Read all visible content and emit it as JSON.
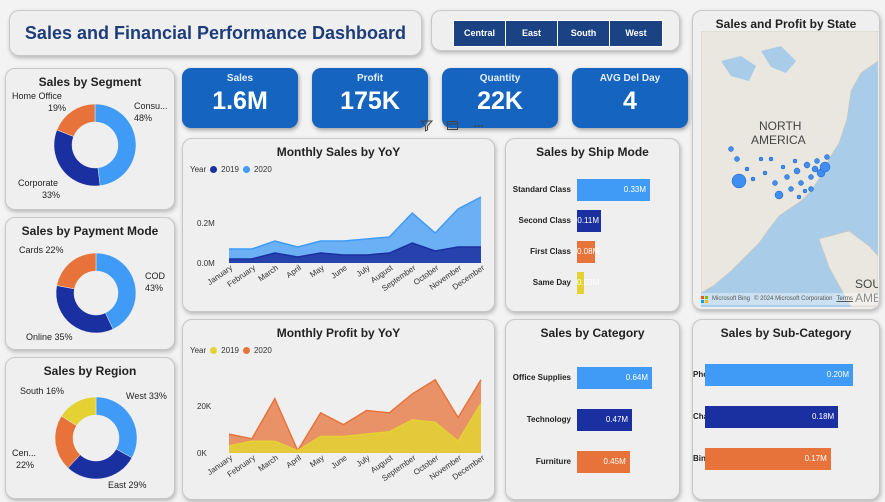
{
  "title": "Sales and Financial Performance Dashboard",
  "region_slicer": [
    "Central",
    "East",
    "South",
    "West"
  ],
  "kpis": [
    {
      "label": "Sales",
      "value": "1.6M"
    },
    {
      "label": "Profit",
      "value": "175K"
    },
    {
      "label": "Quantity",
      "value": "22K"
    },
    {
      "label": "AVG Del Day",
      "value": "4"
    }
  ],
  "colors": {
    "dark_blue": "#1a2fa0",
    "light_blue": "#3f9bf5",
    "orange": "#e8733a",
    "yellow": "#e3d232",
    "kpi_blue": "#1565c0",
    "title_blue": "#1c3d7a"
  },
  "map": {
    "title": "Sales and Profit by State",
    "labels": [
      "NORTH",
      "AMERICA",
      "SOU",
      "AME"
    ],
    "attribution": "© 2024 Microsoft Corporation",
    "logo": "Microsoft Bing",
    "terms": "Terms"
  },
  "visual_icons": [
    "filter-icon",
    "focus-mode-icon",
    "more-options-icon"
  ],
  "chart_data": [
    {
      "type": "pie",
      "title": "Sales by Segment",
      "labels": [
        "Consu...",
        "Corporate",
        "Home Office"
      ],
      "label_display": [
        "Consu...",
        "Corporate",
        "Home Office"
      ],
      "pct_display": [
        "48%",
        "33%",
        "19%"
      ],
      "values": [
        48,
        33,
        19
      ],
      "colors": [
        "#3f9bf5",
        "#1a2fa0",
        "#e8733a"
      ]
    },
    {
      "type": "pie",
      "title": "Sales by Payment Mode",
      "labels": [
        "COD",
        "Online",
        "Cards"
      ],
      "label_display": [
        "COD",
        "Online 35%",
        "Cards 22%"
      ],
      "pct_display": [
        "43%",
        "",
        ""
      ],
      "values": [
        43,
        35,
        22
      ],
      "colors": [
        "#3f9bf5",
        "#1a2fa0",
        "#e8733a"
      ]
    },
    {
      "type": "pie",
      "title": "Sales by Region",
      "labels": [
        "West",
        "East",
        "Cen...",
        "South"
      ],
      "label_display": [
        "West 33%",
        "East 29%",
        "Cen...",
        "South 16%"
      ],
      "pct_display": [
        "",
        "",
        "22%",
        ""
      ],
      "values": [
        33,
        29,
        22,
        16
      ],
      "colors": [
        "#3f9bf5",
        "#1a2fa0",
        "#e8733a",
        "#e3d232"
      ]
    },
    {
      "type": "area",
      "title": "Monthly Sales by YoY",
      "legend_title": "Year",
      "categories": [
        "January",
        "February",
        "March",
        "April",
        "May",
        "June",
        "July",
        "August",
        "September",
        "October",
        "November",
        "December"
      ],
      "series": [
        {
          "name": "2019",
          "color": "#1a2fa0",
          "values": [
            0.02,
            0.02,
            0.05,
            0.03,
            0.05,
            0.04,
            0.04,
            0.05,
            0.1,
            0.06,
            0.08,
            0.08
          ]
        },
        {
          "name": "2020",
          "color": "#3f9bf5",
          "values": [
            0.07,
            0.07,
            0.11,
            0.08,
            0.11,
            0.11,
            0.12,
            0.13,
            0.25,
            0.15,
            0.27,
            0.33
          ]
        }
      ],
      "yticks": [
        "0.0M",
        "0.2M"
      ],
      "ylim": [
        0,
        0.36
      ]
    },
    {
      "type": "area",
      "title": "Monthly Profit by YoY",
      "legend_title": "Year",
      "categories": [
        "January",
        "February",
        "March",
        "April",
        "May",
        "June",
        "July",
        "August",
        "September",
        "October",
        "November",
        "December"
      ],
      "series": [
        {
          "name": "2019",
          "color": "#e3d232",
          "values": [
            3000,
            5000,
            5000,
            1000,
            7000,
            7000,
            8000,
            9000,
            14000,
            13000,
            5000,
            21000
          ]
        },
        {
          "name": "2020",
          "color": "#e8733a",
          "values": [
            8000,
            6000,
            23000,
            1000,
            17000,
            12000,
            18000,
            17000,
            25000,
            31000,
            15000,
            31000
          ]
        }
      ],
      "yticks": [
        "0K",
        "20K"
      ],
      "ylim": [
        0,
        36000
      ]
    },
    {
      "type": "bar",
      "title": "Sales by Ship Mode",
      "categories": [
        "Standard Class",
        "Second Class",
        "First Class",
        "Same Day"
      ],
      "values": [
        0.33,
        0.11,
        0.08,
        0.03
      ],
      "labels": [
        "0.33M",
        "0.11M",
        "0.08M",
        "0.03M"
      ],
      "colors": [
        "#3f9bf5",
        "#1a2fa0",
        "#e8733a",
        "#e3d232"
      ]
    },
    {
      "type": "bar",
      "title": "Sales by Category",
      "categories": [
        "Office Supplies",
        "Technology",
        "Furniture"
      ],
      "values": [
        0.64,
        0.47,
        0.45
      ],
      "labels": [
        "0.64M",
        "0.47M",
        "0.45M"
      ],
      "colors": [
        "#3f9bf5",
        "#1a2fa0",
        "#e8733a"
      ]
    },
    {
      "type": "bar",
      "title": "Sales by Sub-Category",
      "categories": [
        "Phones",
        "Chairs",
        "Binders"
      ],
      "values": [
        0.2,
        0.18,
        0.17
      ],
      "labels": [
        "0.20M",
        "0.18M",
        "0.17M"
      ],
      "colors": [
        "#3f9bf5",
        "#1a2fa0",
        "#e8733a"
      ]
    }
  ]
}
